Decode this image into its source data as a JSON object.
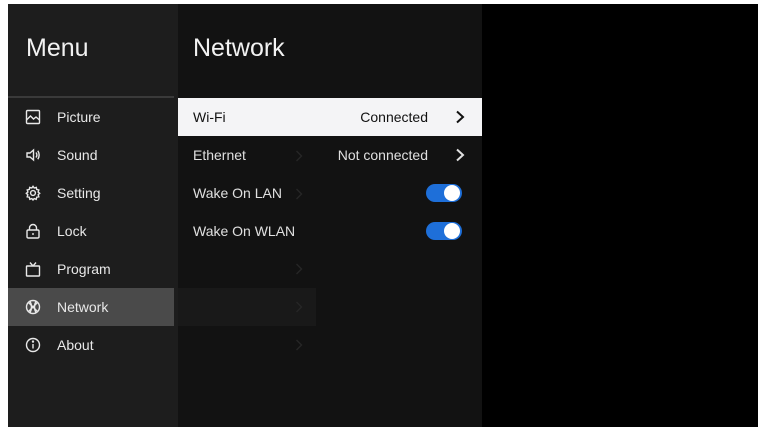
{
  "menu": {
    "title": "Menu",
    "items": [
      {
        "label": "Picture",
        "icon": "picture-icon"
      },
      {
        "label": "Sound",
        "icon": "speaker-icon"
      },
      {
        "label": "Setting",
        "icon": "gear-icon"
      },
      {
        "label": "Lock",
        "icon": "lock-icon"
      },
      {
        "label": "Program",
        "icon": "tv-icon"
      },
      {
        "label": "Network",
        "icon": "globe-icon",
        "active": true
      },
      {
        "label": "About",
        "icon": "info-icon"
      }
    ]
  },
  "network": {
    "title": "Network",
    "rows": [
      {
        "label": "Wi-Fi",
        "value": "Connected",
        "type": "link",
        "selected": true
      },
      {
        "label": "Ethernet",
        "value": "Not connected",
        "type": "link"
      },
      {
        "label": "Wake On LAN",
        "type": "toggle",
        "on": true
      },
      {
        "label": "Wake On WLAN",
        "type": "toggle",
        "on": true
      }
    ]
  },
  "colors": {
    "toggle_on": "#1e6fd9",
    "selected_row": "#f4f4f6",
    "active_menu": "#4a4a4a"
  }
}
